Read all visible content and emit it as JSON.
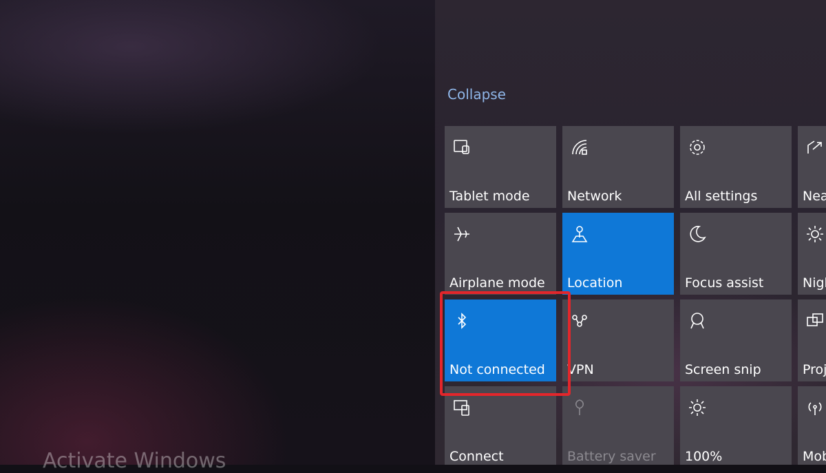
{
  "desktop": {
    "watermark": "Activate Windows"
  },
  "action_center": {
    "collapse_label": "Collapse",
    "tiles": [
      {
        "label": "Tablet mode",
        "icon": "tablet-mode-icon",
        "state": "normal"
      },
      {
        "label": "Network",
        "icon": "network-icon",
        "state": "normal"
      },
      {
        "label": "All settings",
        "icon": "gear-icon",
        "state": "normal"
      },
      {
        "label": "Nea",
        "icon": "nearby-share-icon",
        "state": "normal"
      },
      {
        "label": "Airplane mode",
        "icon": "airplane-icon",
        "state": "normal"
      },
      {
        "label": "Location",
        "icon": "location-icon",
        "state": "active"
      },
      {
        "label": "Focus assist",
        "icon": "moon-icon",
        "state": "normal"
      },
      {
        "label": "Nigh",
        "icon": "night-light-icon",
        "state": "normal"
      },
      {
        "label": "Not connected",
        "icon": "bluetooth-icon",
        "state": "active"
      },
      {
        "label": "VPN",
        "icon": "vpn-icon",
        "state": "normal"
      },
      {
        "label": "Screen snip",
        "icon": "screen-snip-icon",
        "state": "normal"
      },
      {
        "label": "Proj",
        "icon": "project-icon",
        "state": "normal"
      },
      {
        "label": "Connect",
        "icon": "connect-icon",
        "state": "normal"
      },
      {
        "label": "Battery saver",
        "icon": "battery-saver-icon",
        "state": "disabled"
      },
      {
        "label": "100%",
        "icon": "brightness-icon",
        "state": "normal"
      },
      {
        "label": "Mob",
        "icon": "mobile-hotspot-icon",
        "state": "normal"
      }
    ]
  },
  "colors": {
    "accent": "#0f78d7",
    "tile": "#4a474f",
    "highlight": "#e3262b",
    "link": "#8fb6e8"
  }
}
